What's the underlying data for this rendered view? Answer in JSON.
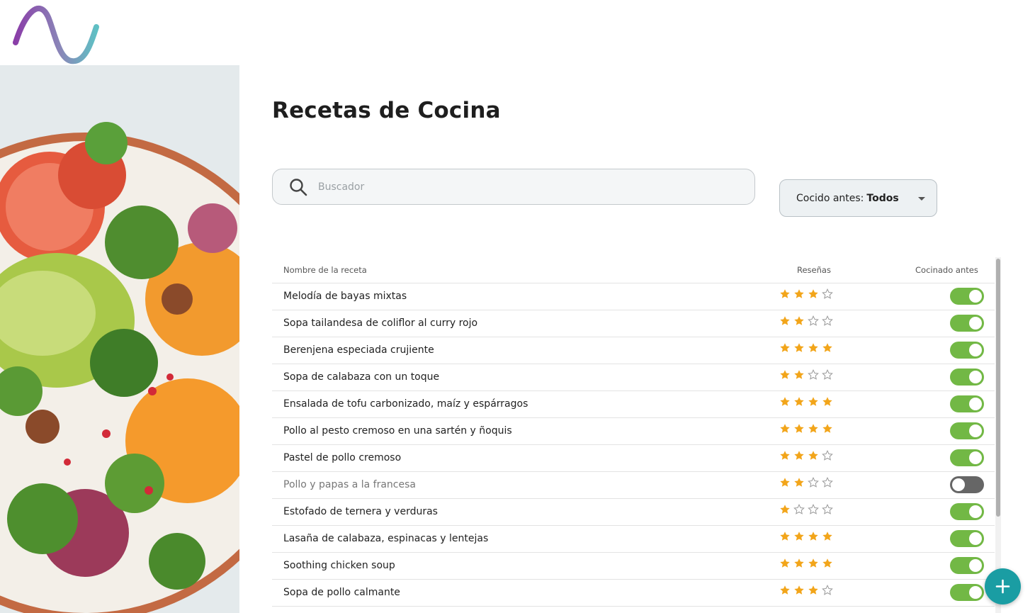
{
  "page": {
    "title": "Recetas de Cocina"
  },
  "search": {
    "placeholder": "Buscador"
  },
  "filter": {
    "label": "Cocido antes:",
    "value": "Todos"
  },
  "table": {
    "columns": {
      "name": "Nombre de la receta",
      "reviews": "Reseñas",
      "cooked": "Cocinado antes"
    },
    "rows": [
      {
        "name": "Melodía de bayas mixtas",
        "rating": 3,
        "cooked": true
      },
      {
        "name": "Sopa tailandesa de coliflor al curry rojo",
        "rating": 2,
        "cooked": true
      },
      {
        "name": "Berenjena especiada crujiente",
        "rating": 4,
        "cooked": true
      },
      {
        "name": "Sopa de calabaza con un toque",
        "rating": 2,
        "cooked": true
      },
      {
        "name": "Ensalada de tofu carbonizado, maíz y espárragos",
        "rating": 4,
        "cooked": true
      },
      {
        "name": "Pollo al pesto cremoso en una sartén y ñoquis",
        "rating": 4,
        "cooked": true
      },
      {
        "name": "Pastel de pollo cremoso",
        "rating": 3,
        "cooked": true
      },
      {
        "name": "Pollo y papas a la francesa",
        "rating": 2,
        "cooked": false
      },
      {
        "name": "Estofado de ternera y verduras",
        "rating": 1,
        "cooked": true
      },
      {
        "name": "Lasaña de calabaza, espinacas y lentejas",
        "rating": 4,
        "cooked": true
      },
      {
        "name": "Soothing chicken soup",
        "rating": 4,
        "cooked": true
      },
      {
        "name": "Sopa de pollo calmante",
        "rating": 3,
        "cooked": true
      }
    ]
  },
  "rating_max": 4,
  "colors": {
    "accent": "#1a9da3",
    "toggle_on": "#72b845",
    "toggle_off": "#666666",
    "star": "#f2a51a"
  },
  "icons": {
    "logo": "wave-logo-icon",
    "search": "search-icon",
    "add": "plus-icon",
    "caret": "caret-down-icon"
  }
}
